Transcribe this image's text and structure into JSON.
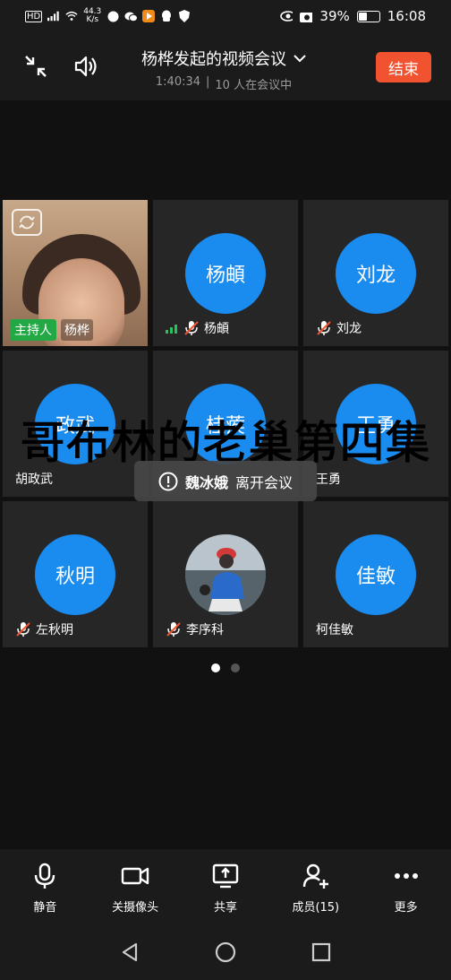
{
  "status_bar": {
    "network": "HD",
    "speed": "44.3",
    "speed_unit": "K/s",
    "battery": "39%",
    "time": "16:08"
  },
  "header": {
    "title": "杨桦发起的视频会议",
    "duration": "1:40:34",
    "separator": "|",
    "participants_text": "10 人在会议中",
    "end_label": "结束"
  },
  "tiles": [
    {
      "avatar": "",
      "name": "杨桦",
      "badge": "主持人"
    },
    {
      "avatar": "杨頔",
      "name": "杨頔"
    },
    {
      "avatar": "刘龙",
      "name": "刘龙"
    },
    {
      "avatar": "政武",
      "name": "胡政武"
    },
    {
      "avatar": "桂蒺",
      "name": ""
    },
    {
      "avatar": "王勇",
      "name": "王勇"
    },
    {
      "avatar": "秋明",
      "name": "左秋明"
    },
    {
      "avatar": "",
      "name": "李序科"
    },
    {
      "avatar": "佳敏",
      "name": "柯佳敏"
    }
  ],
  "overlay": {
    "caption": "哥布林的老巢第四集"
  },
  "toast": {
    "name": "魏冰娥",
    "message": "离开会议"
  },
  "toolbar": {
    "mute": "静音",
    "camera_off": "关摄像头",
    "share": "共享",
    "members": "成员(15)",
    "more": "更多"
  },
  "colors": {
    "accent_blue": "#1a8cf0",
    "end_red": "#f1522f",
    "host_green": "#22a845"
  }
}
